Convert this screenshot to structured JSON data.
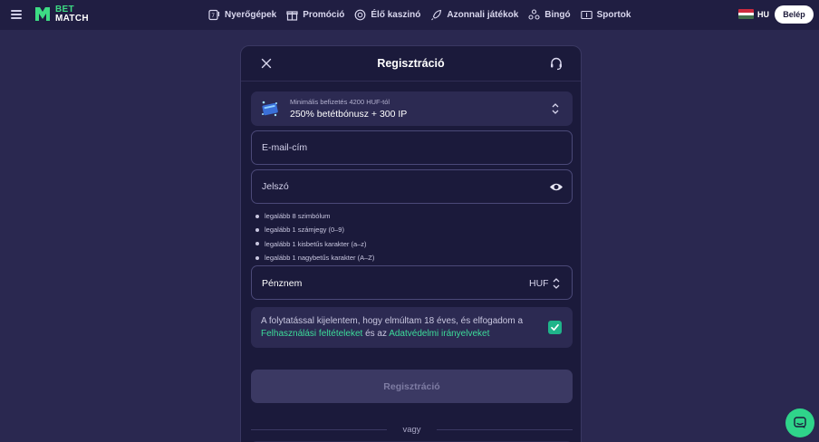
{
  "topbar": {
    "logo_line1": "BET",
    "logo_line2": "MATCH",
    "nav": [
      {
        "label": "Nyerőgépek",
        "icon": "slot-machine-icon"
      },
      {
        "label": "Promóció",
        "icon": "gift-icon"
      },
      {
        "label": "Élő kaszinó",
        "icon": "casino-chip-icon"
      },
      {
        "label": "Azonnali játékok",
        "icon": "rocket-icon"
      },
      {
        "label": "Bingó",
        "icon": "bingo-icon"
      },
      {
        "label": "Sportok",
        "icon": "scoreboard-icon"
      }
    ],
    "language": "HU",
    "login_label": "Belép"
  },
  "modal": {
    "title": "Regisztráció",
    "bonus": {
      "min_deposit": "Minimális befizetés 4200 HUF-tól",
      "offer": "250% betétbónusz + 300 IP"
    },
    "email_placeholder": "E-mail-cím",
    "password_placeholder": "Jelszó",
    "password_rules": [
      "legalább 8 szimbólum",
      "legalább 1 számjegy (0–9)",
      "legalább 1 kisbetűs karakter (a–z)",
      "legalább 1 nagybetűs karakter (A–Z)"
    ],
    "currency_label": "Pénznem",
    "currency_value": "HUF",
    "consent": {
      "text_before": "A folytatással kijelentem, hogy elmúltam 18 éves, és elfogadom a ",
      "terms_link": "Felhasználási feltételeket",
      "text_middle": " és az ",
      "privacy_link": "Adatvédelmi irányelveket",
      "checked": true
    },
    "submit_label": "Regisztráció",
    "divider_label": "vagy"
  },
  "colors": {
    "background": "#2a2850",
    "modal": "#1b1a3b",
    "accent": "#3ddc84",
    "link": "#3ddc9a"
  }
}
